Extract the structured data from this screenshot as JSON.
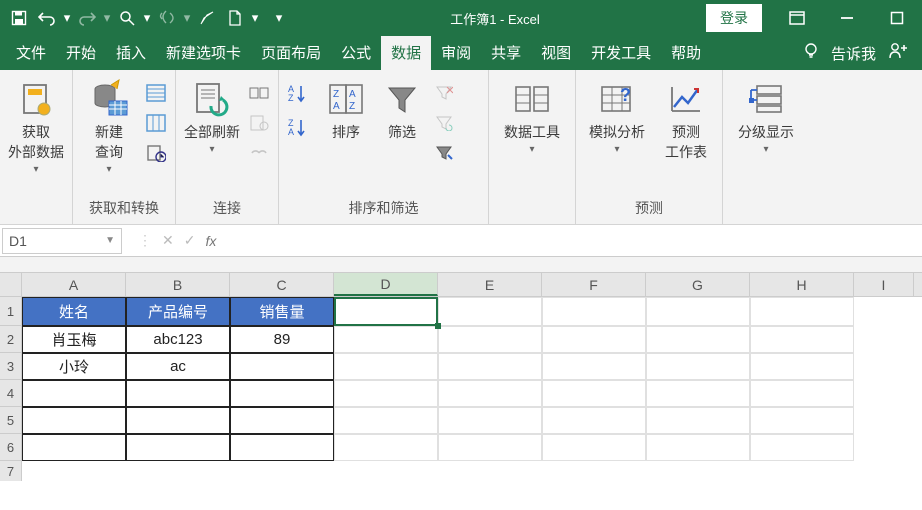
{
  "title": "工作簿1 - Excel",
  "login": "登录",
  "tabs": {
    "file": "文件",
    "home": "开始",
    "insert": "插入",
    "newtab": "新建选项卡",
    "layout": "页面布局",
    "formula": "公式",
    "data": "数据",
    "review": "审阅",
    "share": "共享",
    "view": "视图",
    "dev": "开发工具",
    "help": "帮助",
    "tell": "告诉我"
  },
  "ribbon": {
    "g1": {
      "btn": "获取\n外部数据",
      "label": ""
    },
    "g2": {
      "btn": "新建\n查询",
      "label": "获取和转换"
    },
    "g3": {
      "btn": "全部刷新",
      "label": "连接"
    },
    "g4": {
      "sort": "排序",
      "filter": "筛选",
      "label": "排序和筛选"
    },
    "g5": {
      "btn": "数据工具",
      "label": ""
    },
    "g6": {
      "btn1": "模拟分析",
      "btn2": "预测\n工作表",
      "label": "预测"
    },
    "g7": {
      "btn": "分级显示",
      "label": ""
    }
  },
  "namebox": "D1",
  "columns": [
    "A",
    "B",
    "C",
    "D",
    "E",
    "F",
    "G",
    "H",
    "I"
  ],
  "rows": [
    "1",
    "2",
    "3",
    "4",
    "5",
    "6",
    "7"
  ],
  "table": {
    "header": [
      "姓名",
      "产品编号",
      "销售量"
    ],
    "data": [
      [
        "肖玉梅",
        "abc123",
        "89"
      ],
      [
        "小玲",
        "ac",
        ""
      ],
      [
        "",
        "",
        ""
      ],
      [
        "",
        "",
        ""
      ],
      [
        "",
        "",
        ""
      ]
    ]
  },
  "chart_data": {
    "type": "table",
    "columns": [
      "姓名",
      "产品编号",
      "销售量"
    ],
    "rows": [
      {
        "姓名": "肖玉梅",
        "产品编号": "abc123",
        "销售量": 89
      },
      {
        "姓名": "小玲",
        "产品编号": "ac",
        "销售量": null
      }
    ]
  }
}
